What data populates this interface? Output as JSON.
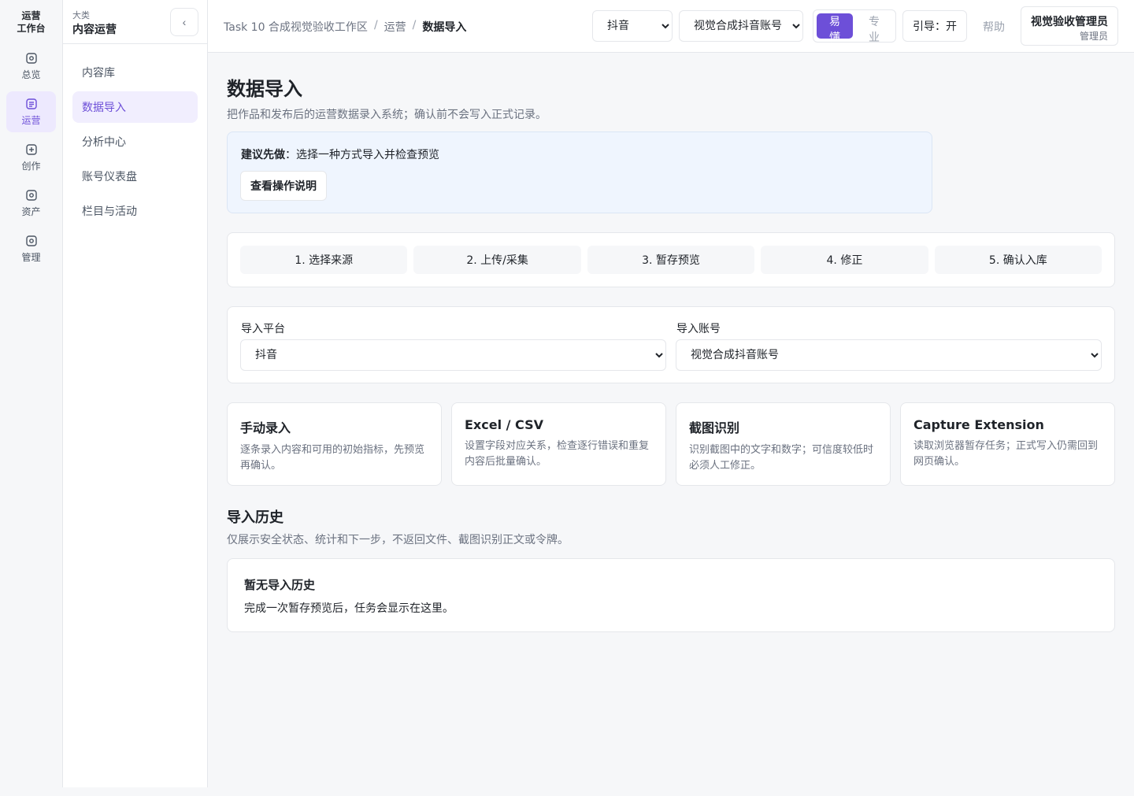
{
  "rail": {
    "title_line1": "运营",
    "title_line2": "工作台",
    "items": [
      {
        "label": "总览",
        "icon": "overview-icon"
      },
      {
        "label": "运营",
        "icon": "operations-icon",
        "active": true
      },
      {
        "label": "创作",
        "icon": "create-icon"
      },
      {
        "label": "资产",
        "icon": "assets-icon"
      },
      {
        "label": "管理",
        "icon": "manage-icon"
      }
    ]
  },
  "sidebar": {
    "category_label": "大类",
    "category_name": "内容运营",
    "collapse_glyph": "‹",
    "items": [
      {
        "label": "内容库"
      },
      {
        "label": "数据导入",
        "active": true
      },
      {
        "label": "分析中心"
      },
      {
        "label": "账号仪表盘"
      },
      {
        "label": "栏目与活动"
      }
    ]
  },
  "topbar": {
    "breadcrumb": [
      "Task 10 合成视觉验收工作区",
      "运营",
      "数据导入"
    ],
    "breadcrumb_sep": "/",
    "platform_select": "抖音",
    "account_select": "视觉合成抖音账号",
    "mode_easy": "易懂",
    "mode_pro": "专业",
    "guide_label": "引导：开",
    "help_label": "帮助",
    "user_name": "视觉验收管理员",
    "user_role": "管理员"
  },
  "main": {
    "title": "数据导入",
    "subtitle": "把作品和发布后的运营数据录入系统；确认前不会写入正式记录。",
    "tip_prefix": "建议先做",
    "tip_text": "：选择一种方式导入并检查预览",
    "tip_button": "查看操作说明",
    "steps": [
      "1. 选择来源",
      "2. 上传/采集",
      "3. 暂存预览",
      "4. 修正",
      "5. 确认入库"
    ],
    "form": {
      "platform_label": "导入平台",
      "platform_value": "抖音",
      "account_label": "导入账号",
      "account_value": "视觉合成抖音账号"
    },
    "methods": [
      {
        "title": "手动录入",
        "desc": "逐条录入内容和可用的初始指标，先预览再确认。"
      },
      {
        "title": "Excel / CSV",
        "desc": "设置字段对应关系，检查逐行错误和重复内容后批量确认。"
      },
      {
        "title": "截图识别",
        "desc": "识别截图中的文字和数字；可信度较低时必须人工修正。"
      },
      {
        "title": "Capture Extension",
        "desc": "读取浏览器暂存任务；正式写入仍需回到网页确认。"
      }
    ],
    "history_title": "导入历史",
    "history_sub": "仅展示安全状态、统计和下一步，不返回文件、截图识别正文或令牌。",
    "history_empty_title": "暂无导入历史",
    "history_empty_desc": "完成一次暂存预览后，任务会显示在这里。"
  },
  "colors": {
    "accent": "#6d4fd8",
    "accent_soft": "#ede9fe",
    "tip_bg": "#eff5fe"
  }
}
